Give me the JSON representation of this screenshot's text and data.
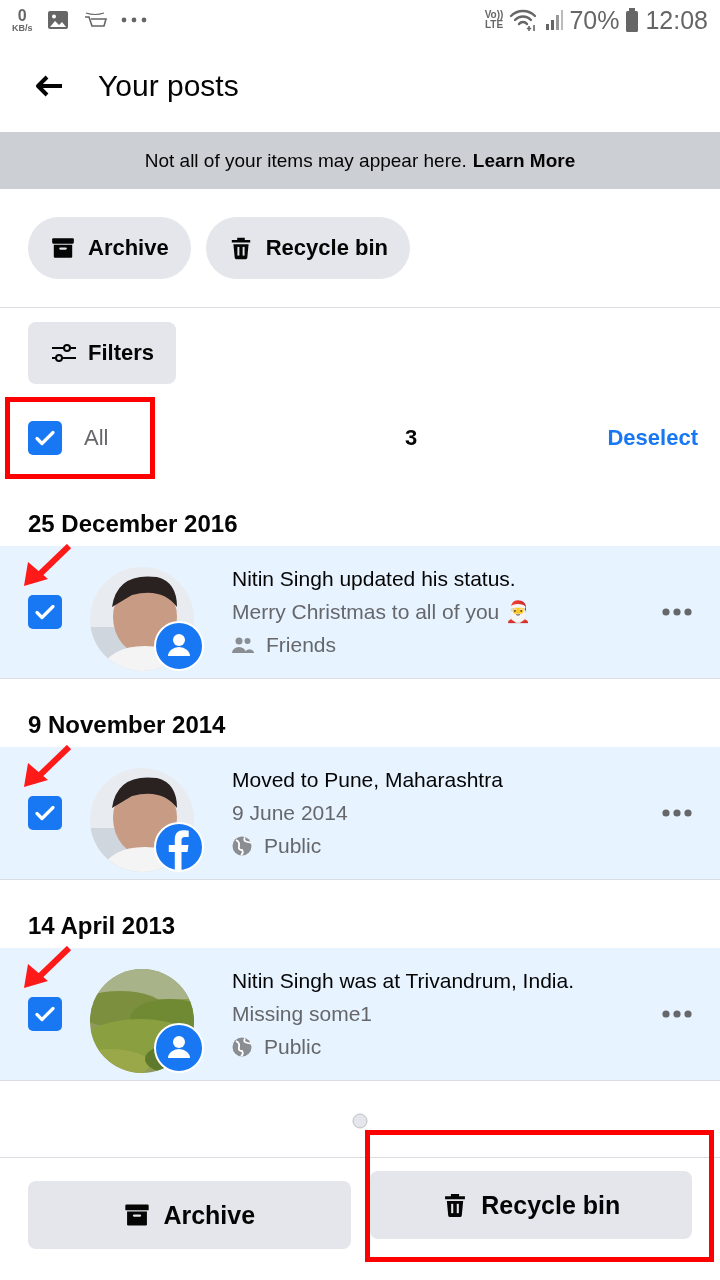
{
  "status_bar": {
    "speed": "0",
    "speed_unit": "KB/s",
    "network": "Vo))",
    "network_type": "LTE",
    "battery": "70%",
    "time": "12:08"
  },
  "header": {
    "title": "Your posts"
  },
  "notice": {
    "text": "Not all of your items may appear here.",
    "link": "Learn More"
  },
  "top_actions": [
    {
      "kind": "archive",
      "label": "Archive"
    },
    {
      "kind": "trash",
      "label": "Recycle bin"
    }
  ],
  "filters": {
    "label": "Filters"
  },
  "selection": {
    "label": "All",
    "checked": true,
    "highlighted": true,
    "count": "3",
    "action": "Deselect"
  },
  "posts": [
    {
      "date": "25 December 2016",
      "checked": true,
      "arrow": true,
      "badge": {
        "kind": "person"
      },
      "title": "Nitin Singh updated his status.",
      "subtitle": "Merry Christmas to all of you 🎅",
      "audience": {
        "kind": "friends",
        "label": "Friends"
      }
    },
    {
      "date": "9 November 2014",
      "checked": true,
      "arrow": true,
      "badge": {
        "kind": "facebook"
      },
      "title": "Moved to Pune, Maharashtra",
      "subtitle": "9 June 2014",
      "audience": {
        "kind": "public",
        "label": "Public"
      }
    },
    {
      "date": "14 April 2013",
      "checked": true,
      "arrow": true,
      "badge": {
        "kind": "person"
      },
      "title": "Nitin Singh was at Trivandrum, India.",
      "subtitle": "Missing some1",
      "audience": {
        "kind": "public",
        "label": "Public"
      }
    }
  ],
  "bottom_actions": [
    {
      "kind": "archive",
      "label": "Archive",
      "highlighted": false
    },
    {
      "kind": "trash",
      "label": "Recycle bin",
      "highlighted": true
    }
  ]
}
